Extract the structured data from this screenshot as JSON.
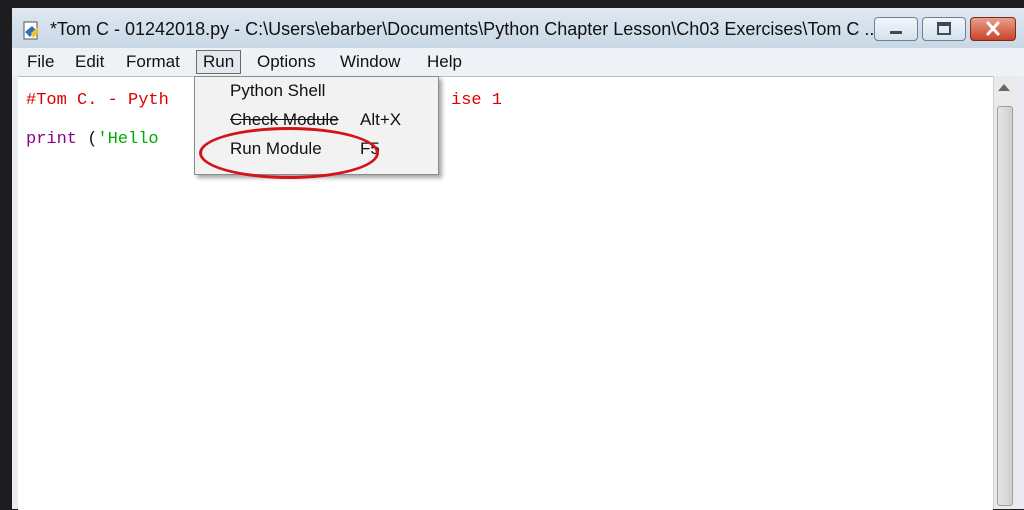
{
  "window": {
    "title": "*Tom C - 01242018.py - C:\\Users\\ebarber\\Documents\\Python Chapter Lesson\\Ch03 Exercises\\Tom C ..."
  },
  "menubar": {
    "items": [
      {
        "label": "File"
      },
      {
        "label": "Edit"
      },
      {
        "label": "Format"
      },
      {
        "label": "Run"
      },
      {
        "label": "Options"
      },
      {
        "label": "Window"
      },
      {
        "label": "Help"
      }
    ]
  },
  "run_menu": {
    "items": [
      {
        "label": "Python Shell",
        "shortcut": ""
      },
      {
        "label": "Check Module",
        "shortcut": "Alt+X"
      },
      {
        "label": "Run Module",
        "shortcut": "F5"
      }
    ]
  },
  "editor": {
    "line1_visible": "#Tom C. - Pyth",
    "line1_tail": "ise 1",
    "line2_keyword": "print",
    "line2_paren": " (",
    "line2_string": "'Hello "
  },
  "colors": {
    "comment": "#dd0000",
    "keyword": "#900090",
    "string": "#00aa00",
    "annotation": "#d4131b"
  },
  "icons": {
    "app": "python-idle-icon",
    "minimize": "minimize-icon",
    "maximize": "maximize-icon",
    "close": "close-icon",
    "scroll_up": "scroll-up-arrow-icon"
  }
}
